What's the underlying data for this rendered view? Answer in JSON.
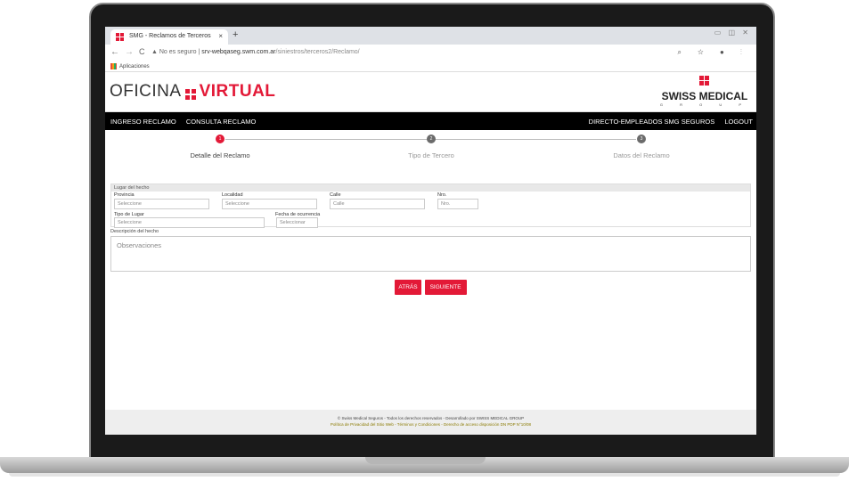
{
  "browser": {
    "tab_title": "SMG - Reclamos de Terceros",
    "tab_close": "×",
    "new_tab": "+",
    "window_controls": "▭ ◫ ✕",
    "nav_back": "←",
    "nav_forward": "→",
    "nav_reload": "C",
    "security_text": "No es seguro",
    "url_host": "srv-webqaseg.swm.com.ar",
    "url_path": "/siniestros/terceros2/Reclamo/",
    "address_icons": "⌕ ☆ ● ⋮",
    "bookmark": "Aplicaciones"
  },
  "site": {
    "logo_left": "OFICINA",
    "logo_right": "VIRTUAL",
    "brand_name": "SWISS MEDICAL",
    "brand_sub": "G R O U P",
    "nav_left": [
      "INGRESO RECLAMO",
      "CONSULTA RECLAMO"
    ],
    "nav_right": [
      "DIRECTO-EMPLEADOS SMG SEGUROS",
      "LOGOUT"
    ]
  },
  "steps": [
    {
      "number": "1",
      "label": "Detalle del Reclamo",
      "color": "#e31937"
    },
    {
      "number": "2",
      "label": "Tipo de Tercero",
      "color": "#6b6b6b"
    },
    {
      "number": "3",
      "label": "Datos del Reclamo",
      "color": "#6b6b6b"
    }
  ],
  "form": {
    "section_title": "Lugar del hecho",
    "provincia_label": "Provincia",
    "provincia_value": "Seleccione",
    "localidad_label": "Localidad",
    "localidad_value": "Seleccione",
    "calle_label": "Calle",
    "calle_placeholder": "Calle",
    "nro_label": "Nro.",
    "nro_placeholder": "Nro.",
    "tipo_lugar_label": "Tipo de Lugar",
    "tipo_lugar_value": "Seleccione",
    "fecha_label": "Fecha de ocurrencia",
    "fecha_placeholder": "Seleccionar",
    "descripcion_label": "Descripción del hecho",
    "descripcion_placeholder": "Observaciones"
  },
  "buttons": {
    "back": "ATRÁS",
    "next": "SIGUIENTE"
  },
  "footer": {
    "line1": "© Swiss Medical Seguros - Todos los derechos reservados - Desarrollado por SWISS MEDICAL GROUP",
    "line2": "Política de Privacidad del Sitio Web - Términos y Condiciones - Derecho de acceso disposición DN PDP N°10/08"
  },
  "colors": {
    "accent": "#e31937",
    "navbar": "#000000"
  }
}
